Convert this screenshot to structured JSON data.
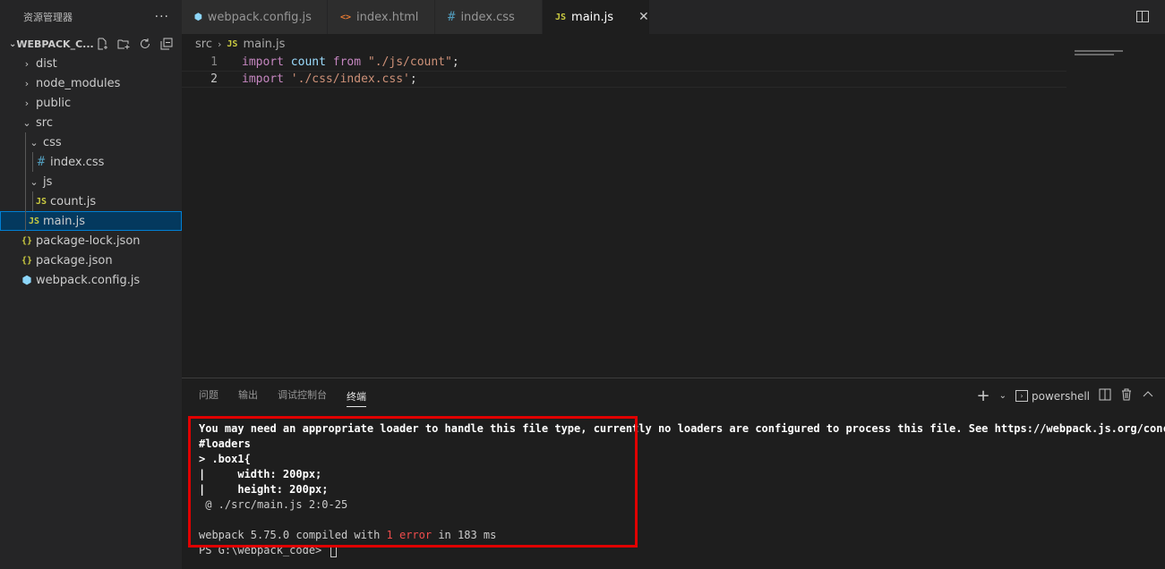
{
  "sidebar": {
    "title": "资源管理器",
    "more": "···",
    "section": "WEBPACK_C...",
    "tree": [
      {
        "label": "dist",
        "type": "folder",
        "depth": 0,
        "open": false
      },
      {
        "label": "node_modules",
        "type": "folder",
        "depth": 0,
        "open": false
      },
      {
        "label": "public",
        "type": "folder",
        "depth": 0,
        "open": false
      },
      {
        "label": "src",
        "type": "folder",
        "depth": 0,
        "open": true
      },
      {
        "label": "css",
        "type": "folder",
        "depth": 1,
        "open": true
      },
      {
        "label": "index.css",
        "type": "css",
        "depth": 2
      },
      {
        "label": "js",
        "type": "folder",
        "depth": 1,
        "open": true
      },
      {
        "label": "count.js",
        "type": "js",
        "depth": 2
      },
      {
        "label": "main.js",
        "type": "js",
        "depth": 1,
        "selected": true
      },
      {
        "label": "package-lock.json",
        "type": "json",
        "depth": 0
      },
      {
        "label": "package.json",
        "type": "json",
        "depth": 0
      },
      {
        "label": "webpack.config.js",
        "type": "webpack",
        "depth": 0
      }
    ]
  },
  "tabs": [
    {
      "label": "webpack.config.js",
      "icon": "webpack-icon",
      "active": false
    },
    {
      "label": "index.html",
      "icon": "html-icon",
      "active": false
    },
    {
      "label": "index.css",
      "icon": "css-icon",
      "active": false
    },
    {
      "label": "main.js",
      "icon": "js-icon",
      "active": true
    }
  ],
  "breadcrumb": {
    "folder": "src",
    "file": "main.js",
    "file_icon": "JS"
  },
  "code": [
    {
      "num": "1",
      "tokens": [
        [
          "kw",
          "import"
        ],
        [
          "pun",
          " "
        ],
        [
          "var",
          "count"
        ],
        [
          "pun",
          " "
        ],
        [
          "kw",
          "from"
        ],
        [
          "pun",
          " "
        ],
        [
          "str",
          "\"./js/count\""
        ],
        [
          "pun",
          ";"
        ]
      ]
    },
    {
      "num": "2",
      "tokens": [
        [
          "kw",
          "import"
        ],
        [
          "pun",
          " "
        ],
        [
          "str",
          "'./css/index.css'"
        ],
        [
          "pun",
          ";"
        ]
      ]
    }
  ],
  "panel": {
    "tabs": [
      "问题",
      "输出",
      "调试控制台",
      "终端"
    ],
    "active_tab": "终端",
    "shell": "powershell"
  },
  "terminal": {
    "line1": "You may need an appropriate loader to handle this file type, currently no loaders are configured to process this file. See https://webpack.js.org/concepts",
    "line2": "#loaders",
    "line3": "> .box1{",
    "line4": "|     width: 200px;",
    "line5": "|     height: 200px;",
    "line6": " @ ./src/main.js 2:0-25",
    "line8_pre": "webpack 5.75.0 compiled with ",
    "line8_err": "1 error",
    "line8_post": " in 183 ms",
    "prompt": "PS G:\\webpack_code> "
  },
  "colors": {
    "accent": "#007fd4",
    "error": "#f14c4c",
    "highlight": "#e00000"
  }
}
